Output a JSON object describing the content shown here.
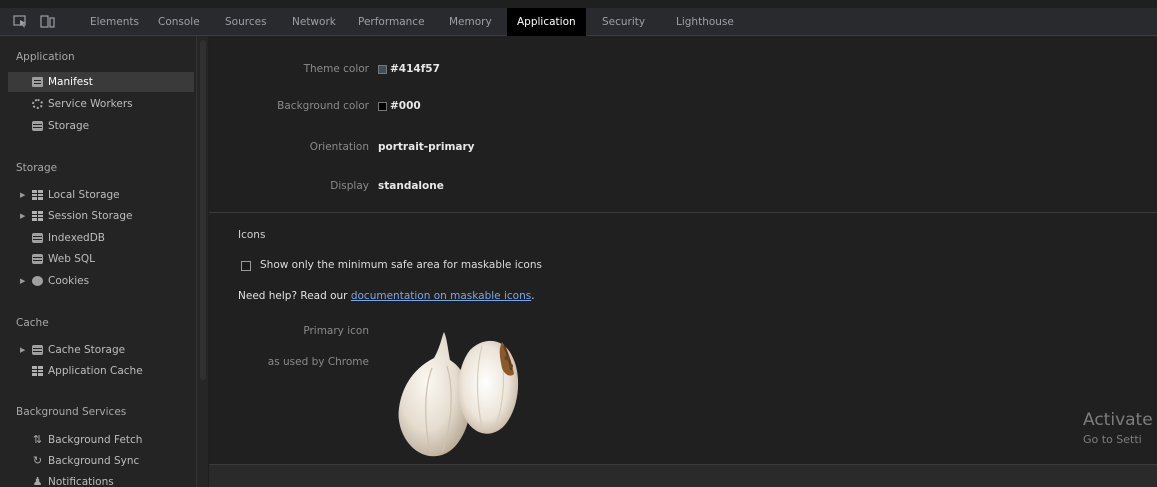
{
  "toolbar": {
    "tabs": [
      "Elements",
      "Console",
      "Sources",
      "Network",
      "Performance",
      "Memory",
      "Application",
      "Security",
      "Lighthouse"
    ],
    "active_tab": "Application"
  },
  "sidebar": {
    "sections": {
      "application": {
        "title": "Application",
        "items": [
          {
            "label": "Manifest",
            "icon": "document-icon"
          },
          {
            "label": "Service Workers",
            "icon": "gear-icon"
          },
          {
            "label": "Storage",
            "icon": "database-icon"
          }
        ]
      },
      "storage": {
        "title": "Storage",
        "items": [
          {
            "label": "Local Storage",
            "icon": "grid-icon"
          },
          {
            "label": "Session Storage",
            "icon": "grid-icon"
          },
          {
            "label": "IndexedDB",
            "icon": "database-icon"
          },
          {
            "label": "Web SQL",
            "icon": "database-icon"
          },
          {
            "label": "Cookies",
            "icon": "cookie-icon"
          }
        ]
      },
      "cache": {
        "title": "Cache",
        "items": [
          {
            "label": "Cache Storage",
            "icon": "database-icon"
          },
          {
            "label": "Application Cache",
            "icon": "grid-icon"
          }
        ]
      },
      "background": {
        "title": "Background Services",
        "items": [
          {
            "label": "Background Fetch",
            "icon": "fetch-icon"
          },
          {
            "label": "Background Sync",
            "icon": "sync-icon"
          },
          {
            "label": "Notifications",
            "icon": "bell-icon"
          }
        ]
      }
    }
  },
  "manifest": {
    "rows": [
      {
        "label": "Theme color",
        "value": "#414f57",
        "swatch": "#414f57"
      },
      {
        "label": "Background color",
        "value": "#000",
        "swatch": "#000000"
      },
      {
        "label": "Orientation",
        "value": "portrait-primary"
      },
      {
        "label": "Display",
        "value": "standalone"
      }
    ],
    "icons": {
      "title": "Icons",
      "checkbox_label": "Show only the minimum safe area for maskable icons",
      "help_prefix": "Need help? Read our ",
      "help_link": "documentation on maskable icons",
      "help_suffix": ".",
      "primary_label": "Primary icon",
      "primary_sub": "as used by Chrome"
    }
  },
  "watermark": {
    "line1": "Activate",
    "line2": "Go to Setti"
  },
  "colors": {
    "background": "#1f1f1f",
    "sidebar": "#242424",
    "selected": "#3a3a3a",
    "link": "#7aa6e8"
  }
}
